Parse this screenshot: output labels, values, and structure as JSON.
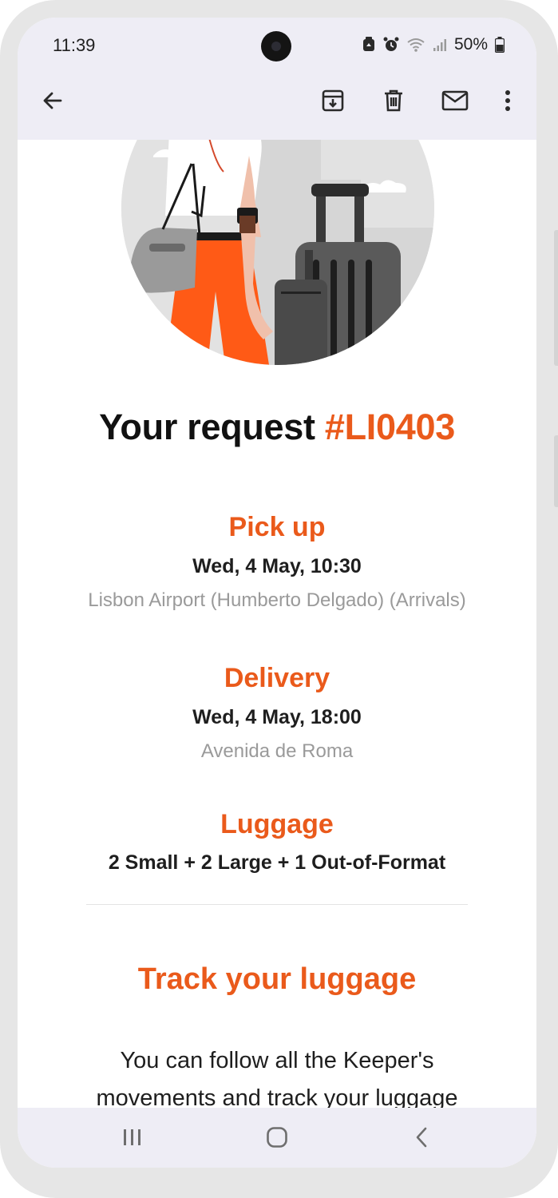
{
  "status_bar": {
    "time": "11:39",
    "battery": "50%"
  },
  "toolbar": {
    "back_icon": "arrow-left-icon",
    "archive_icon": "archive-icon",
    "delete_icon": "trash-icon",
    "mark_unread_icon": "envelope-icon",
    "more_icon": "more-vertical-icon"
  },
  "email": {
    "title_prefix": "Your request ",
    "request_number": "#LI0403",
    "pickup": {
      "heading": "Pick up",
      "datetime": "Wed, 4 May, 10:30",
      "location": "Lisbon Airport (Humberto Delgado) (Arrivals)"
    },
    "delivery": {
      "heading": "Delivery",
      "datetime": "Wed, 4 May, 18:00",
      "location": "Avenida de Roma"
    },
    "luggage": {
      "heading": "Luggage",
      "summary": "2 Small + 2 Large + 1 Out-of-Format"
    },
    "track": {
      "heading": "Track your luggage",
      "body": "You can follow all the Keeper's movements and track your luggage"
    }
  },
  "nav_bar": {
    "recents_icon": "recents-icon",
    "home_icon": "home-icon",
    "back_icon": "back-chevron-icon"
  },
  "colors": {
    "accent": "#ea5a1b",
    "app_bar": "#eeedf5"
  }
}
